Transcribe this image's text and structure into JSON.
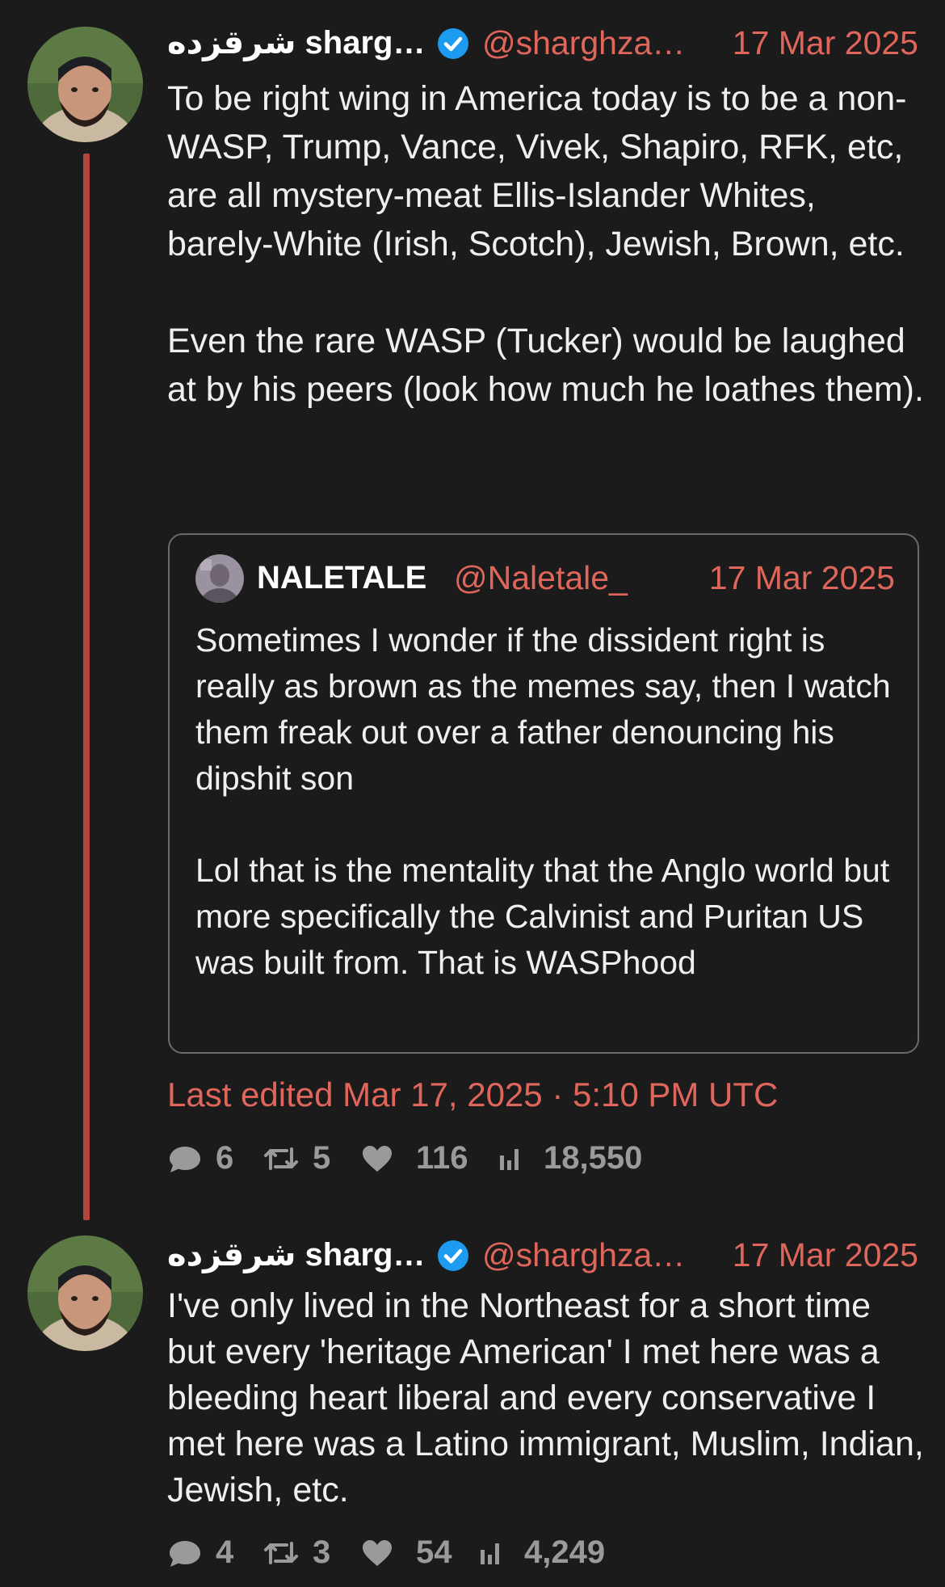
{
  "tweets": [
    {
      "author_name": "شرقزده sharg…",
      "handle": "@sharghza…",
      "date": "17 Mar 2025",
      "paragraphs": [
        "To be right wing in America today is to be a non-WASP, Trump, Vance, Vivek, Shapiro, RFK, etc, are all mystery-meat Ellis-Islander Whites, barely-White (Irish, Scotch), Jewish, Brown, etc.",
        "Even the rare WASP (Tucker) would be laughed at by his peers (look how much he loathes them)."
      ],
      "quote": {
        "author_name": "NALETALE",
        "handle": "@Naletale_",
        "date": "17 Mar 2025",
        "paragraphs": [
          "Sometimes I wonder if the dissident right is really as brown as the memes say, then I watch them freak out over a father denouncing his dipshit son",
          "Lol that is the mentality that the Anglo world but more specifically the Calvinist and Puritan US was built from. That is WASPhood"
        ]
      },
      "edited": "Last edited Mar 17, 2025 · 5:10 PM UTC",
      "stats": {
        "replies": "6",
        "retweets": "5",
        "likes": "116",
        "views": "18,550"
      }
    },
    {
      "author_name": "شرقزده sharg…",
      "handle": "@sharghza…",
      "date": "17 Mar 2025",
      "paragraphs": [
        "I've only lived in the Northeast for a short time but every 'heritage American' I met here was a bleeding heart liberal and every conservative I met here was a Latino immigrant, Muslim, Indian, Jewish, etc."
      ],
      "stats": {
        "replies": "4",
        "retweets": "3",
        "likes": "54",
        "views": "4,249"
      }
    }
  ],
  "icons": {
    "verified": "verified-badge-icon",
    "reply": "reply-bubble-icon",
    "retweet": "retweet-icon",
    "like": "heart-icon",
    "views": "bar-chart-icon"
  },
  "colors": {
    "background": "#1b1b1b",
    "accent": "#e0665c",
    "thread_line": "#b4463f",
    "verified": "#1d9bf0",
    "muted": "#9a9a9a"
  }
}
